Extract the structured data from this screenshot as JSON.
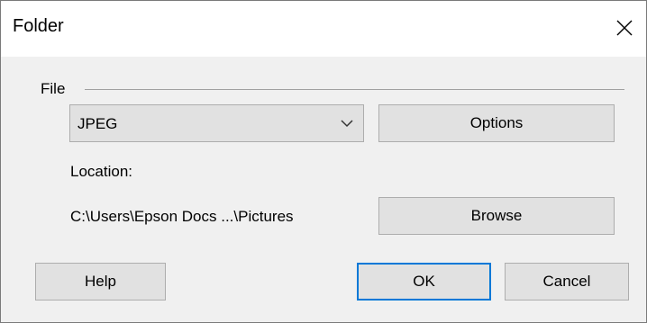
{
  "window": {
    "title": "Folder",
    "close_icon": "close-icon"
  },
  "file_group": {
    "label": "File",
    "format_select": {
      "value": "JPEG",
      "icon": "chevron-down-icon"
    },
    "options_label": "Options"
  },
  "location": {
    "label": "Location:",
    "path": "C:\\Users\\Epson Docs ...\\Pictures",
    "browse_label": "Browse"
  },
  "footer": {
    "help_label": "Help",
    "ok_label": "OK",
    "cancel_label": "Cancel"
  },
  "colors": {
    "focus_border": "#0078d7",
    "dialog_background": "#f0f0f0",
    "button_face": "#e1e1e1"
  }
}
